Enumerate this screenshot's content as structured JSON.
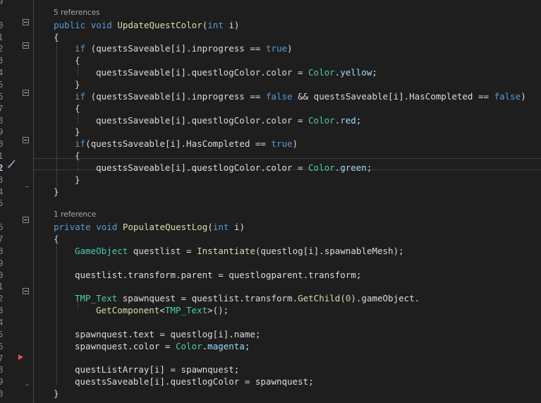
{
  "colors": {
    "background": "#1e1e1e",
    "keyword": "#569cd6",
    "type": "#4ec9b0",
    "method": "#dcdcaa",
    "identifier": "#9cdcfe",
    "number": "#b5cea8",
    "text": "#dcdcdc",
    "line_number": "#858585",
    "breakpoint": "#e05252"
  },
  "editor": {
    "active_line_number": "2",
    "lines": [
      {
        "num": "9",
        "lens": "",
        "tokens": []
      },
      {
        "num": "",
        "lens": "5 references",
        "tokens": []
      },
      {
        "num": "0",
        "lens": "",
        "tokens": [
          [
            "kw",
            "public"
          ],
          [
            "pn",
            " "
          ],
          [
            "kw",
            "void"
          ],
          [
            "pn",
            " "
          ],
          [
            "fn",
            "UpdateQuestColor"
          ],
          [
            "pn",
            "("
          ],
          [
            "kw",
            "int"
          ],
          [
            "pn",
            " i)"
          ]
        ]
      },
      {
        "num": "1",
        "lens": "",
        "tokens": [
          [
            "pn",
            "{"
          ]
        ]
      },
      {
        "num": "2",
        "lens": "",
        "tokens": [
          [
            "kw",
            "if"
          ],
          [
            "pn",
            " (questsSaveable[i].inprogress == "
          ],
          [
            "kw",
            "true"
          ],
          [
            "pn",
            ")"
          ]
        ]
      },
      {
        "num": "3",
        "lens": "",
        "tokens": [
          [
            "pn",
            "{"
          ]
        ]
      },
      {
        "num": "4",
        "lens": "",
        "tokens": [
          [
            "pn",
            "questsSaveable[i].questlogColor.color = "
          ],
          [
            "ty",
            "Color"
          ],
          [
            "pn",
            "."
          ],
          [
            "pr",
            "yellow"
          ],
          [
            "pn",
            ";"
          ]
        ]
      },
      {
        "num": "5",
        "lens": "",
        "tokens": [
          [
            "pn",
            "}"
          ]
        ]
      },
      {
        "num": "6",
        "lens": "",
        "tokens": [
          [
            "kw",
            "if"
          ],
          [
            "pn",
            " (questsSaveable[i].inprogress == "
          ],
          [
            "kw",
            "false"
          ],
          [
            "pn",
            " && questsSaveable[i].HasCompleted == "
          ],
          [
            "kw",
            "false"
          ],
          [
            "pn",
            ")"
          ]
        ]
      },
      {
        "num": "7",
        "lens": "",
        "tokens": [
          [
            "pn",
            "{"
          ]
        ]
      },
      {
        "num": "8",
        "lens": "",
        "tokens": [
          [
            "pn",
            "questsSaveable[i].questlogColor.color = "
          ],
          [
            "ty",
            "Color"
          ],
          [
            "pn",
            "."
          ],
          [
            "pr",
            "red"
          ],
          [
            "pn",
            ";"
          ]
        ]
      },
      {
        "num": "9",
        "lens": "",
        "tokens": [
          [
            "pn",
            "}"
          ]
        ]
      },
      {
        "num": "0",
        "lens": "",
        "tokens": [
          [
            "kw",
            "if"
          ],
          [
            "pn",
            "(questsSaveable[i].HasCompleted == "
          ],
          [
            "kw",
            "true"
          ],
          [
            "pn",
            ")"
          ]
        ]
      },
      {
        "num": "1",
        "lens": "",
        "tokens": [
          [
            "pn",
            "{"
          ]
        ]
      },
      {
        "num": "2",
        "lens": "",
        "tokens": [
          [
            "pn",
            "questsSaveable[i].questlogColor.color = "
          ],
          [
            "ty",
            "Color"
          ],
          [
            "pn",
            "."
          ],
          [
            "pr",
            "green"
          ],
          [
            "pn",
            ";"
          ]
        ]
      },
      {
        "num": "3",
        "lens": "",
        "tokens": [
          [
            "pn",
            "}"
          ]
        ]
      },
      {
        "num": "4",
        "lens": "",
        "tokens": [
          [
            "pn",
            "}"
          ]
        ]
      },
      {
        "num": "5",
        "lens": "",
        "tokens": []
      },
      {
        "num": "",
        "lens": "1 reference",
        "tokens": []
      },
      {
        "num": "6",
        "lens": "",
        "tokens": [
          [
            "kw",
            "private"
          ],
          [
            "pn",
            " "
          ],
          [
            "kw",
            "void"
          ],
          [
            "pn",
            " "
          ],
          [
            "fn",
            "PopulateQuestLog"
          ],
          [
            "pn",
            "("
          ],
          [
            "kw",
            "int"
          ],
          [
            "pn",
            " i)"
          ]
        ]
      },
      {
        "num": "7",
        "lens": "",
        "tokens": [
          [
            "pn",
            "{"
          ]
        ]
      },
      {
        "num": "8",
        "lens": "",
        "tokens": [
          [
            "ty",
            "GameObject"
          ],
          [
            "pn",
            " questlist = "
          ],
          [
            "fn",
            "Instantiate"
          ],
          [
            "pn",
            "(questlog[i].spawnableMesh);"
          ]
        ]
      },
      {
        "num": "9",
        "lens": "",
        "tokens": []
      },
      {
        "num": "0",
        "lens": "",
        "tokens": [
          [
            "pn",
            "questlist.transform.parent = questlogparent.transform;"
          ]
        ]
      },
      {
        "num": "1",
        "lens": "",
        "tokens": []
      },
      {
        "num": "2",
        "lens": "",
        "tokens": [
          [
            "ty",
            "TMP_Text"
          ],
          [
            "pn",
            " spawnquest = questlist.transform."
          ],
          [
            "fn",
            "GetChild"
          ],
          [
            "pn",
            "("
          ],
          [
            "nm",
            "0"
          ],
          [
            "pn",
            ").gameObject."
          ]
        ]
      },
      {
        "num": "3",
        "lens": "",
        "tokens": [
          [
            "fn",
            "GetComponent"
          ],
          [
            "pn",
            "<"
          ],
          [
            "ty",
            "TMP_Text"
          ],
          [
            "pn",
            ">();"
          ]
        ]
      },
      {
        "num": "4",
        "lens": "",
        "tokens": []
      },
      {
        "num": "5",
        "lens": "",
        "tokens": [
          [
            "pn",
            "spawnquest.text = questlog[i].name;"
          ]
        ]
      },
      {
        "num": "6",
        "lens": "",
        "tokens": [
          [
            "pn",
            "spawnquest.color = "
          ],
          [
            "ty",
            "Color"
          ],
          [
            "pn",
            "."
          ],
          [
            "pr",
            "magenta"
          ],
          [
            "pn",
            ";"
          ]
        ]
      },
      {
        "num": "7",
        "lens": "",
        "tokens": []
      },
      {
        "num": "8",
        "lens": "",
        "tokens": [
          [
            "pn",
            "questListArray[i] = spawnquest;"
          ]
        ]
      },
      {
        "num": "9",
        "lens": "",
        "tokens": [
          [
            "pn",
            "questsSaveable[i].questlogColor = spawnquest;"
          ]
        ]
      },
      {
        "num": "0",
        "lens": "",
        "tokens": [
          [
            "pn",
            "}"
          ]
        ]
      },
      {
        "num": "",
        "lens": "",
        "tokens": []
      }
    ]
  }
}
